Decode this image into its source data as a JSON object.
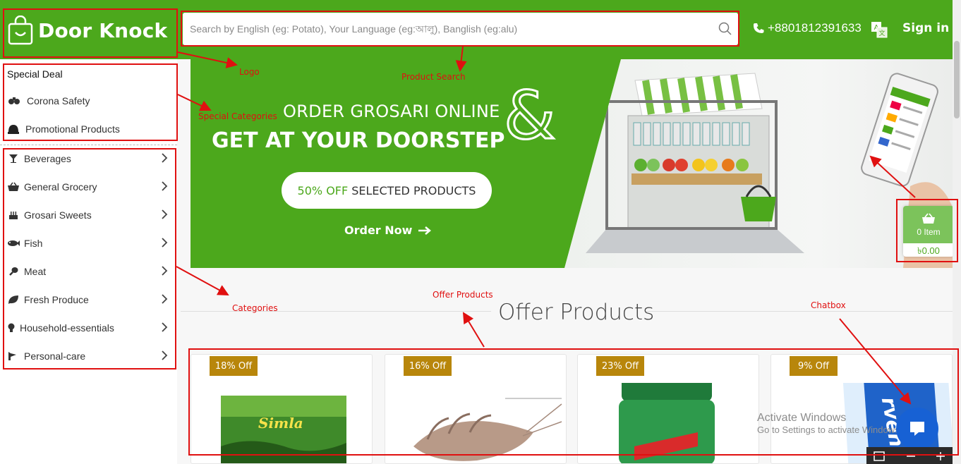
{
  "header": {
    "logo_text": "Door Knock",
    "search_placeholder": "Search by English (eg: Potato), Your Language (eg:আলু), Banglish (eg:alu)",
    "phone": "+8801812391633",
    "signin_label": "Sign in",
    "accent_color": "#4ca81c"
  },
  "sidebar": {
    "special_title": "Special Deal",
    "special_items": [
      {
        "label": "Corona Safety",
        "icon": "virus-icon"
      },
      {
        "label": "Promotional Products",
        "icon": "hat-icon"
      }
    ],
    "categories": [
      {
        "label": "Beverages",
        "icon": "cocktail-icon"
      },
      {
        "label": "General Grocery",
        "icon": "basket-icon"
      },
      {
        "label": "Grosari Sweets",
        "icon": "cake-icon"
      },
      {
        "label": "Fish",
        "icon": "fish-icon"
      },
      {
        "label": "Meat",
        "icon": "drumstick-icon"
      },
      {
        "label": "Fresh Produce",
        "icon": "leaf-icon"
      },
      {
        "label": "Household-essentials",
        "icon": "bulb-icon"
      },
      {
        "label": "Personal-care",
        "icon": "hand-icon"
      }
    ]
  },
  "banner": {
    "line1": "ORDER GROSARI ONLINE",
    "ampersand": "&",
    "line2": "GET AT YOUR DOORSTEP",
    "offer_highlight": "50% OFF",
    "offer_rest": "SELECTED PRODUCTS",
    "order_now": "Order Now"
  },
  "cart": {
    "count_label": "0 Item",
    "total": "৳0.00"
  },
  "offers": {
    "heading": "Offer Products",
    "products": [
      {
        "badge": "18% Off",
        "image": "simla-tea-pack"
      },
      {
        "badge": "16% Off",
        "image": "shrimp"
      },
      {
        "badge": "23% Off",
        "image": "green-jar"
      },
      {
        "badge": "9% Off",
        "image": "handwash-pouch"
      }
    ]
  },
  "system": {
    "activate_title": "Activate Windows",
    "activate_sub": "Go to Settings to activate Windows."
  },
  "annotations": {
    "logo": "Logo",
    "product_search": "Product Search",
    "special_categories": "Special Categories",
    "categories": "Categories",
    "offer_products": "Offer Products",
    "chatbox": "Chatbox"
  }
}
